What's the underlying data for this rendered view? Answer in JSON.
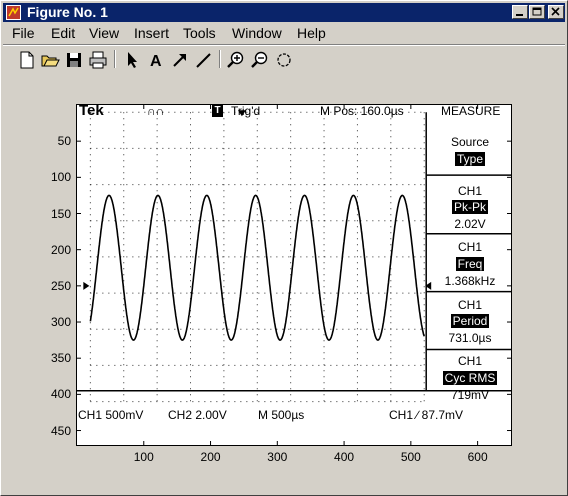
{
  "window": {
    "title": "Figure No. 1"
  },
  "menu": {
    "items": [
      "File",
      "Edit",
      "View",
      "Insert",
      "Tools",
      "Window",
      "Help"
    ]
  },
  "toolbar": {
    "buttons": [
      "new-file-icon",
      "open-folder-icon",
      "save-icon",
      "print-icon",
      "select-arrow-icon",
      "text-icon",
      "arrow-icon",
      "line-icon",
      "zoom-in-icon",
      "zoom-out-icon",
      "rotate-icon"
    ]
  },
  "scope": {
    "brand": "Tek",
    "trigger_state": "Trig'd",
    "trigger_marker": "T",
    "mpos": "M Pos: 160.0µs",
    "measure_title": "MEASURE",
    "source_label": "Source",
    "type_label": "Type",
    "meas1_ch": "CH1",
    "meas1_type": "Pk-Pk",
    "meas1_value": "2.02V",
    "meas2_ch": "CH1",
    "meas2_type": "Freq",
    "meas2_value": "1.368kHz",
    "meas3_ch": "CH1",
    "meas3_type": "Period",
    "meas3_value": "731.0µs",
    "meas4_ch": "CH1",
    "meas4_type": "Cyc RMS",
    "meas4_value": "719mV",
    "status_ch1": "CH1  500mV",
    "status_ch2": "CH2  2.00V",
    "status_m": "M  500µs",
    "status_trig": "CH1  ∕  87.7mV"
  },
  "chart_data": {
    "type": "line",
    "title": "",
    "xlabel": "",
    "ylabel": "",
    "xlim": [
      0,
      650
    ],
    "ylim": [
      470,
      0
    ],
    "x_ticks": [
      100,
      200,
      300,
      400,
      500,
      600
    ],
    "y_ticks": [
      50,
      100,
      150,
      200,
      250,
      300,
      350,
      400,
      450
    ],
    "series": [
      {
        "center_y": 225,
        "amplitude": 100,
        "period_x": 73.2,
        "phase_peak_x": 48,
        "x_start": 20,
        "x_end": 520,
        "color": "#000000"
      }
    ]
  },
  "colors": {
    "titlebar": "#0a246a",
    "window_bg": "#d4d0c8",
    "axes_bg": "#ffffff"
  }
}
